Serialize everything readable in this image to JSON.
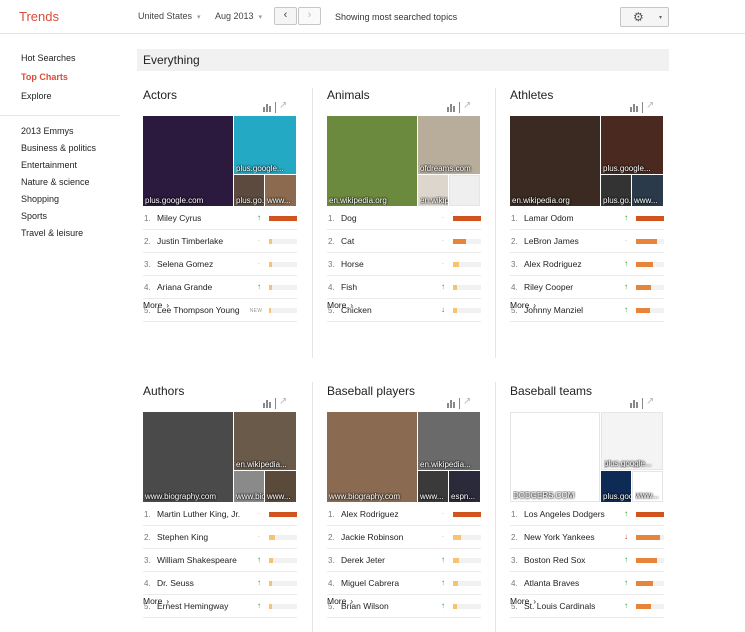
{
  "app": {
    "title": "Trends"
  },
  "topbar": {
    "region": "United States",
    "date": "Aug 2013",
    "prev": "‹",
    "next": "›",
    "showing": "Showing most searched topics",
    "gear": "⚙",
    "gear_caret": "▾",
    "caret": "▾"
  },
  "sidebar": {
    "primary": [
      "Hot Searches",
      "Top Charts",
      "Explore"
    ],
    "active_index": 1,
    "categories": [
      "2013 Emmys",
      "Business & politics",
      "Entertainment",
      "Nature & science",
      "Shopping",
      "Sports",
      "Travel & leisure"
    ]
  },
  "main": {
    "section_title": "Everything"
  },
  "more_label": "More",
  "more_arrow": "›",
  "tools": {
    "separator": "|",
    "trend_icon": "↗"
  },
  "colors": {
    "brand": "#dd4b39",
    "bar_top": "#d1531d",
    "bar_mid": "#e8843a",
    "bar_low": "#f6c371",
    "up": "#1a9b2e",
    "down": "#c0392b"
  },
  "cards": [
    {
      "title": "Actors",
      "images": [
        {
          "caption": "plus.google.com",
          "color": "#2b1a3d"
        },
        {
          "caption": "plus.google...",
          "color": "#23a9c4"
        },
        {
          "caption": "plus.go...",
          "color": "#5c4a3e"
        },
        {
          "caption": "www...",
          "color": "#8b6a4f"
        }
      ],
      "items": [
        {
          "rank": "1.",
          "name": "Miley Cyrus",
          "trend": "up",
          "level": 1.0
        },
        {
          "rank": "2.",
          "name": "Justin Timberlake",
          "trend": "flat",
          "level": 0.12
        },
        {
          "rank": "3.",
          "name": "Selena Gomez",
          "trend": "flat",
          "level": 0.1
        },
        {
          "rank": "4.",
          "name": "Ariana Grande",
          "trend": "up",
          "level": 0.09
        },
        {
          "rank": "5.",
          "name": "Lee Thompson Young",
          "trend": "new",
          "level": 0.08
        }
      ]
    },
    {
      "title": "Animals",
      "images": [
        {
          "caption": "en.wikipedia.org",
          "color": "#6c8a3e"
        },
        {
          "caption": "ofdreams.com",
          "color": "#b8ac9a"
        },
        {
          "caption": "en.wikipedia...",
          "color": "#dcd6cc"
        },
        {
          "caption": "",
          "color": "#efefef"
        }
      ],
      "items": [
        {
          "rank": "1.",
          "name": "Dog",
          "trend": "flat",
          "level": 1.0
        },
        {
          "rank": "2.",
          "name": "Cat",
          "trend": "flat",
          "level": 0.45
        },
        {
          "rank": "3.",
          "name": "Horse",
          "trend": "flat",
          "level": 0.22
        },
        {
          "rank": "4.",
          "name": "Fish",
          "trend": "up",
          "level": 0.16
        },
        {
          "rank": "5.",
          "name": "Chicken",
          "trend": "down",
          "level": 0.14
        }
      ]
    },
    {
      "title": "Athletes",
      "images": [
        {
          "caption": "en.wikipedia.org",
          "color": "#3a2a22"
        },
        {
          "caption": "plus.google...",
          "color": "#4a2a20"
        },
        {
          "caption": "plus.go...",
          "color": "#333333"
        },
        {
          "caption": "www...",
          "color": "#2a3a4a"
        }
      ],
      "items": [
        {
          "rank": "1.",
          "name": "Lamar Odom",
          "trend": "up",
          "level": 1.0
        },
        {
          "rank": "2.",
          "name": "LeBron James",
          "trend": "flat",
          "level": 0.75
        },
        {
          "rank": "3.",
          "name": "Alex Rodriguez",
          "trend": "up",
          "level": 0.62
        },
        {
          "rank": "4.",
          "name": "Riley Cooper",
          "trend": "up",
          "level": 0.55
        },
        {
          "rank": "5.",
          "name": "Johnny Manziel",
          "trend": "up",
          "level": 0.5
        }
      ]
    },
    {
      "title": "Authors",
      "images": [
        {
          "caption": "www.biography.com",
          "color": "#4a4a4a"
        },
        {
          "caption": "en.wikipedia...",
          "color": "#6a5a4a"
        },
        {
          "caption": "www.biog...",
          "color": "#8a8a8a"
        },
        {
          "caption": "www...",
          "color": "#5a4a3a"
        }
      ],
      "items": [
        {
          "rank": "1.",
          "name": "Martin Luther King, Jr.",
          "trend": "flat",
          "level": 1.0
        },
        {
          "rank": "2.",
          "name": "Stephen King",
          "trend": "flat",
          "level": 0.2
        },
        {
          "rank": "3.",
          "name": "William Shakespeare",
          "trend": "up",
          "level": 0.16
        },
        {
          "rank": "4.",
          "name": "Dr. Seuss",
          "trend": "up",
          "level": 0.12
        },
        {
          "rank": "5.",
          "name": "Ernest Hemingway",
          "trend": "up",
          "level": 0.1
        }
      ]
    },
    {
      "title": "Baseball players",
      "images": [
        {
          "caption": "www.biography.com",
          "color": "#8a6a50"
        },
        {
          "caption": "en.wikipedia...",
          "color": "#6a6a6a"
        },
        {
          "caption": "www...",
          "color": "#3a3a3a"
        },
        {
          "caption": "espn...",
          "color": "#2a2a3a"
        }
      ],
      "items": [
        {
          "rank": "1.",
          "name": "Alex Rodriguez",
          "trend": "flat",
          "level": 1.0
        },
        {
          "rank": "2.",
          "name": "Jackie Robinson",
          "trend": "flat",
          "level": 0.3
        },
        {
          "rank": "3.",
          "name": "Derek Jeter",
          "trend": "up",
          "level": 0.2
        },
        {
          "rank": "4.",
          "name": "Miguel Cabrera",
          "trend": "up",
          "level": 0.18
        },
        {
          "rank": "5.",
          "name": "Brian Wilson",
          "trend": "up",
          "level": 0.15
        }
      ]
    },
    {
      "title": "Baseball teams",
      "images": [
        {
          "caption": "DODGERS.COM",
          "color": "#ffffff"
        },
        {
          "caption": "plus.google...",
          "color": "#f4f4f4"
        },
        {
          "caption": "plus.google.com",
          "color": "#0e2b55"
        },
        {
          "caption": "www...",
          "color": "#ffffff"
        }
      ],
      "items": [
        {
          "rank": "1.",
          "name": "Los Angeles Dodgers",
          "trend": "up",
          "level": 1.0
        },
        {
          "rank": "2.",
          "name": "New York Yankees",
          "trend": "down",
          "level": 0.85
        },
        {
          "rank": "3.",
          "name": "Boston Red Sox",
          "trend": "up",
          "level": 0.75
        },
        {
          "rank": "4.",
          "name": "Atlanta Braves",
          "trend": "up",
          "level": 0.6
        },
        {
          "rank": "5.",
          "name": "St. Louis Cardinals",
          "trend": "up",
          "level": 0.55
        }
      ]
    }
  ]
}
